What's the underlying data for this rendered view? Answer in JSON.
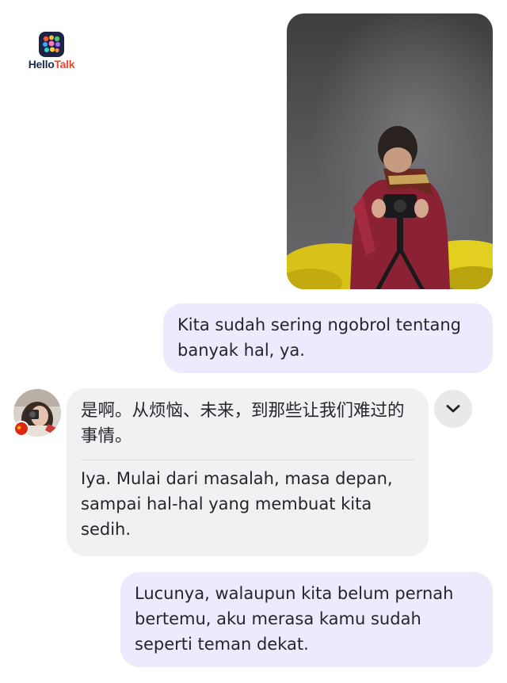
{
  "app": {
    "logo_hello": "Hello",
    "logo_talk": "Talk",
    "icon": "hellotalk-logo-icon"
  },
  "chat": {
    "photo_message": {
      "icon": "photo-image"
    },
    "sent_message_1": "Kita sudah sering ngobrol tentang banyak hal, ya.",
    "received_message": {
      "original": "是啊。从烦恼、未来，到那些让我们难过的事情。",
      "translation": "Iya. Mulai dari masalah, masa depan, sampai hal-hal yang membuat kita sedih.",
      "sender_flag": "china-flag-icon",
      "expand_icon": "chevron-down-icon"
    },
    "sent_message_2": "Lucunya, walaupun kita belum pernah bertemu, aku merasa kamu sudah seperti teman dekat."
  },
  "colors": {
    "outgoing_bubble": "#eceafd",
    "incoming_bubble": "#f1f1f3",
    "logo_navy": "#1d2a55",
    "logo_orange": "#e8482f"
  }
}
